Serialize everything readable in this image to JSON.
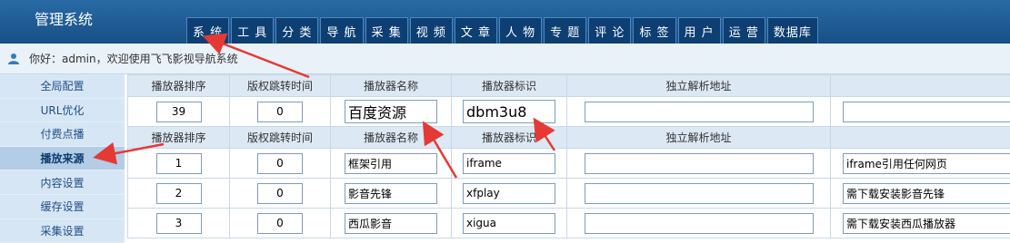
{
  "header": {
    "app_title": "管理系统",
    "nav_tabs": [
      "系 统",
      "工 具",
      "分 类",
      "导 航",
      "采 集",
      "视 频",
      "文 章",
      "人 物",
      "专 题",
      "评 论",
      "标 签",
      "用 户",
      "运 营",
      "数据库"
    ]
  },
  "welcome": {
    "text": "你好：admin，欢迎使用飞飞影视导航系统",
    "icon": "user-icon"
  },
  "sidebar": {
    "items": [
      "全局配置",
      "URL优化",
      "付费点播",
      "播放来源",
      "内容设置",
      "缓存设置",
      "采集设置"
    ],
    "active_index": 3
  },
  "table": {
    "headers": [
      "播放器排序",
      "版权跳转时间",
      "播放器名称",
      "播放器标识",
      "独立解析地址",
      ""
    ],
    "new_row": {
      "order": "39",
      "jump": "0",
      "name": "百度资源",
      "code": "dbm3u8",
      "url": "",
      "desc": ""
    },
    "rows": [
      {
        "order": "1",
        "jump": "0",
        "name": "框架引用",
        "code": "iframe",
        "url": "",
        "desc": "iframe引用任何网页"
      },
      {
        "order": "2",
        "jump": "0",
        "name": "影音先锋",
        "code": "xfplay",
        "url": "",
        "desc": "需下载安装影音先锋"
      },
      {
        "order": "3",
        "jump": "0",
        "name": "西瓜影音",
        "code": "xigua",
        "url": "",
        "desc": "需下载安装西瓜播放器"
      }
    ]
  },
  "colors": {
    "header_bg": "#1d5b93",
    "tab_bg": "#0d3f73",
    "sidebar_bg": "#cfe0f1",
    "arrow": "#e53935"
  }
}
